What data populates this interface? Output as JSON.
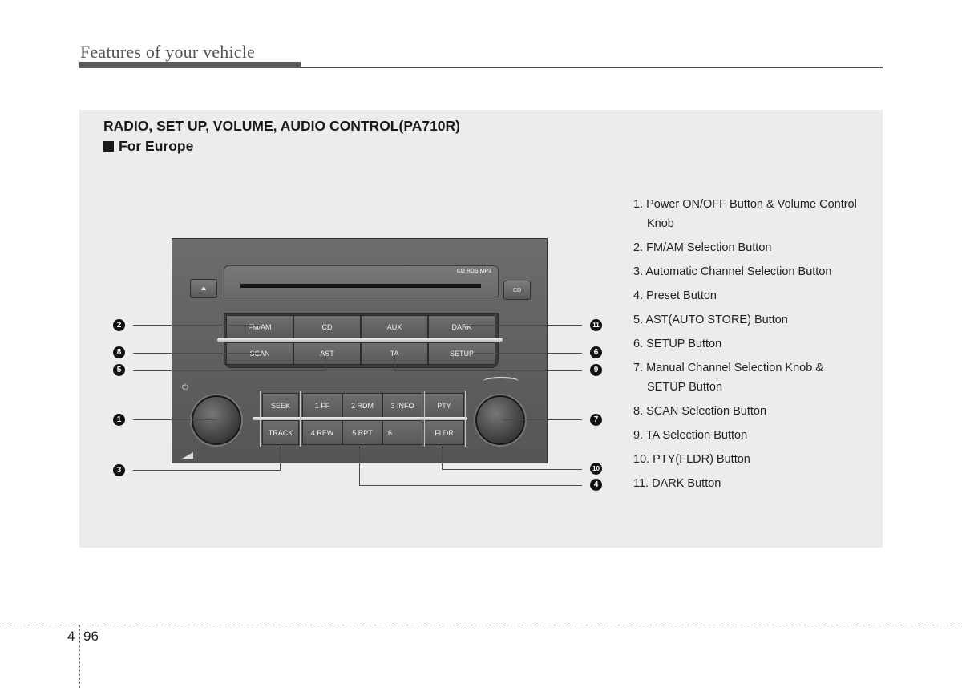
{
  "header": {
    "title": "Features of your vehicle"
  },
  "section": {
    "title": "RADIO, SET UP, VOLUME, AUDIO  CONTROL(PA710R)",
    "subtitle": "For Europe"
  },
  "radio": {
    "cd_logo": "CD RDS MP3",
    "eject_icon": "⏏",
    "cd_button": "CD",
    "upper_buttons": [
      "FM/AM",
      "CD",
      "AUX",
      "DARK"
    ],
    "lower_buttons": [
      "SCAN",
      "AST",
      "TA",
      "SETUP"
    ],
    "seek": "SEEK",
    "track": "TRACK",
    "presets_top": [
      "1  FF",
      "2 RDM",
      "3 INFO"
    ],
    "presets_bottom": [
      "4 REW",
      "5 RPT",
      "6"
    ],
    "pty": "PTY",
    "fldr": "FLDR",
    "power_icon": "⏻",
    "up_chevron": "^",
    "down_chevron": "v"
  },
  "callouts": {
    "left": [
      "❷",
      "❽",
      "❺",
      "❶",
      "❸"
    ],
    "right": [
      "⓫",
      "❻",
      "❾",
      "❼",
      "❿",
      "❹"
    ]
  },
  "legend": [
    {
      "text": "1. Power ON/OFF Button & Volume Control",
      "cont": "Knob"
    },
    {
      "text": "2. FM/AM Selection Button"
    },
    {
      "text": "3. Automatic Channel Selection Button"
    },
    {
      "text": "4. Preset Button"
    },
    {
      "text": "5. AST(AUTO STORE) Button"
    },
    {
      "text": "6. SETUP Button"
    },
    {
      "text": "7. Manual Channel Selection Knob &",
      "cont": "SETUP Button"
    },
    {
      "text": "8. SCAN Selection Button"
    },
    {
      "text": "9. TA Selection Button"
    },
    {
      "text": "10. PTY(FLDR) Button"
    },
    {
      "text": "11. DARK Button"
    }
  ],
  "footer": {
    "chapter": "4",
    "page": "96"
  }
}
